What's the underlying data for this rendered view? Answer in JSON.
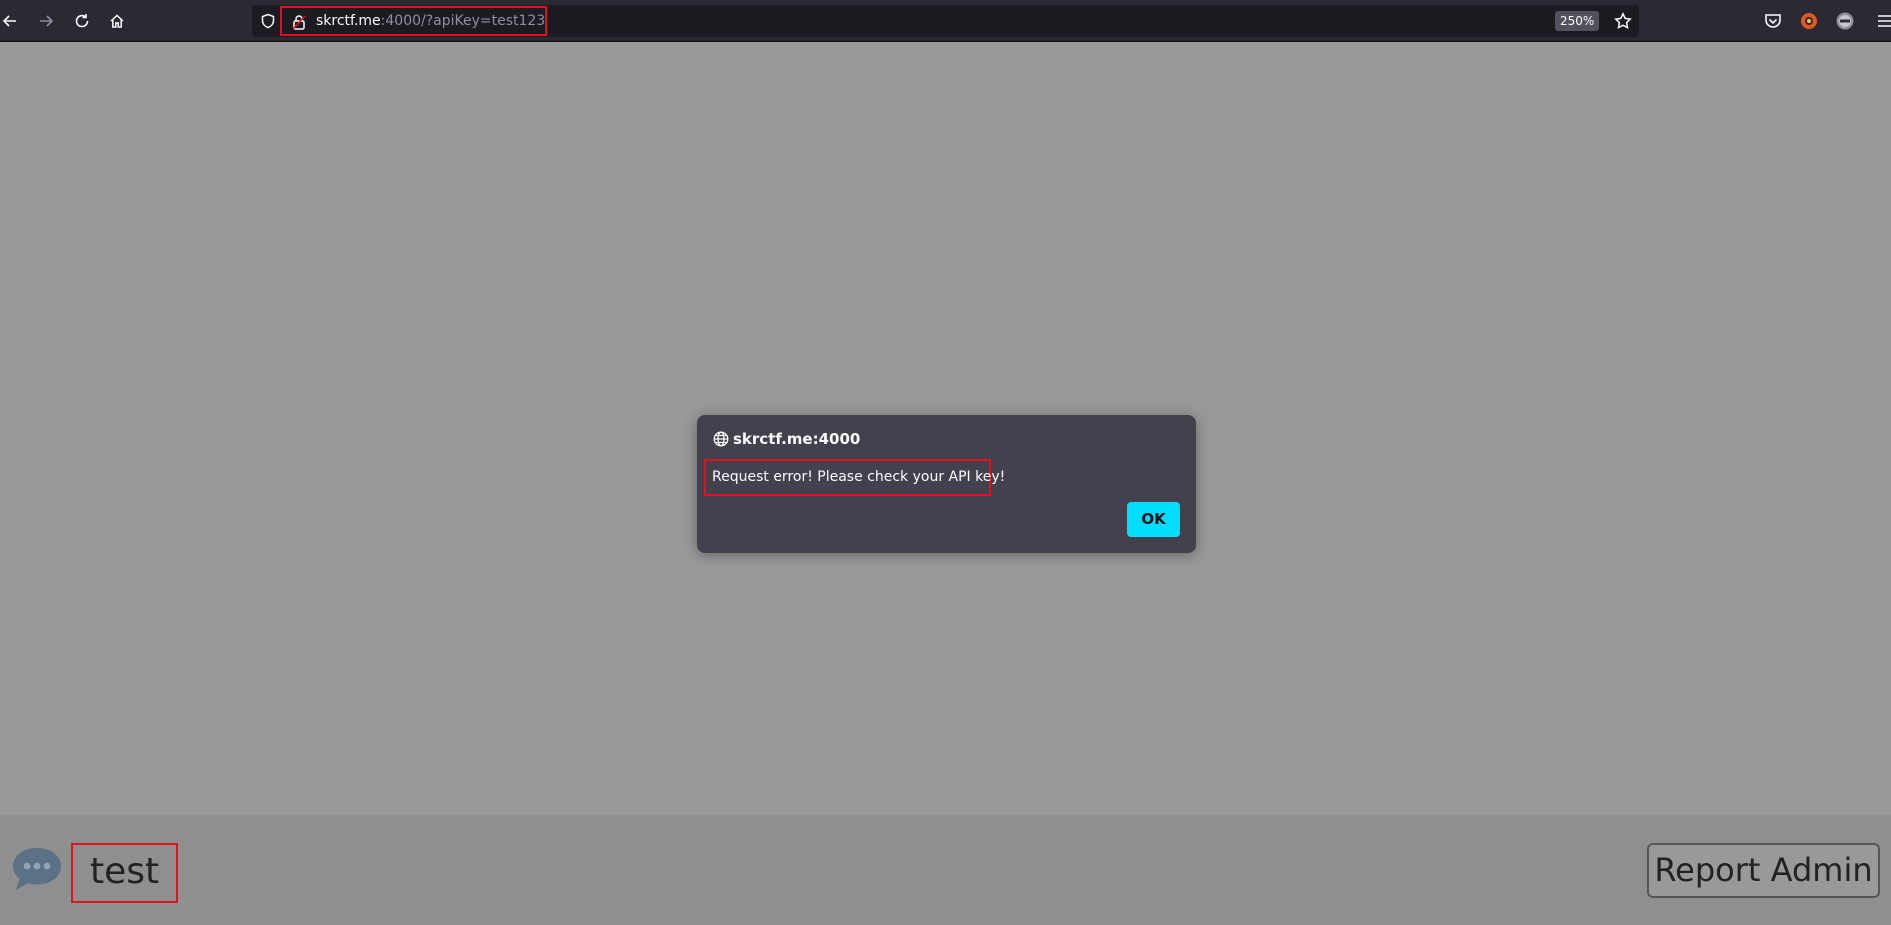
{
  "browser": {
    "url_host": "skrctf.me",
    "url_rest": ":4000/?apiKey=test123",
    "zoom_level": "250%"
  },
  "dialog": {
    "origin": "skrctf.me:4000",
    "message": "Request error! Please check your API key!",
    "ok_label": "OK"
  },
  "page": {
    "username": "test",
    "report_button_label": "Report Admin"
  }
}
